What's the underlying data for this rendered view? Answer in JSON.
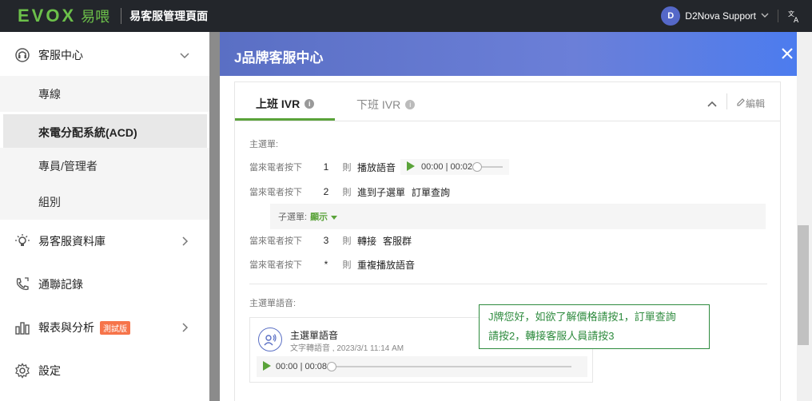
{
  "topbar": {
    "logo_latin": "EVOX",
    "logo_cjk": "易喂",
    "app_title": "易客服管理頁面",
    "user_initial": "D",
    "user_name": "D2Nova Support"
  },
  "sidebar": {
    "items": [
      {
        "label": "客服中心",
        "icon": "headset-icon",
        "expanded": true
      },
      {
        "label": "易客服資料庫",
        "icon": "bulb-icon"
      },
      {
        "label": "通聯記錄",
        "icon": "phone-icon"
      },
      {
        "label": "報表與分析",
        "icon": "bar-chart-icon",
        "badge": "測試版"
      },
      {
        "label": "設定",
        "icon": "gear-icon"
      }
    ],
    "subitems": [
      {
        "label": "專線"
      },
      {
        "label": "來電分配系統(ACD)",
        "active": true
      },
      {
        "label": "專員/管理者"
      },
      {
        "label": "組別"
      }
    ]
  },
  "modal": {
    "title": "J品牌客服中心",
    "tabs": [
      {
        "label": "上班 IVR",
        "active": true
      },
      {
        "label": "下班 IVR",
        "active": false
      }
    ],
    "edit_label": "編輯",
    "main_menu_label": "主選單:",
    "rows": [
      {
        "prefix": "當來電者按下",
        "key": "1",
        "then": "則",
        "action": "播放語音",
        "time": "00:00 | 00:02"
      },
      {
        "prefix": "當來電者按下",
        "key": "2",
        "then": "則",
        "action": "進到子選單",
        "target": "訂單查詢"
      },
      {
        "prefix": "當來電者按下",
        "key": "3",
        "then": "則",
        "action": "轉接",
        "target": "客服群"
      },
      {
        "prefix": "當來電者按下",
        "key": "*",
        "then": "則",
        "action": "重複播放語音"
      }
    ],
    "submenu": {
      "label": "子選單:",
      "toggle": "顯示"
    },
    "voice_section_label": "主選單語音:",
    "voice": {
      "title": "主選單語音",
      "subtitle": "文字轉語音 , 2023/3/1 11:14 AM",
      "time": "00:00 | 00:08"
    },
    "tooltip": {
      "line1": "J牌您好，如欲了解價格請按1，訂單查詢",
      "line2": "請按2，轉接客服人員請按3"
    }
  },
  "colors": {
    "topbar_bg": "#23262b",
    "brand_green": "#6cc04a",
    "header_blue": "#5a6fc4",
    "tab_accent": "#5aa33a",
    "badge_orange": "#f6744a",
    "tooltip_green": "#2e8b3e"
  }
}
